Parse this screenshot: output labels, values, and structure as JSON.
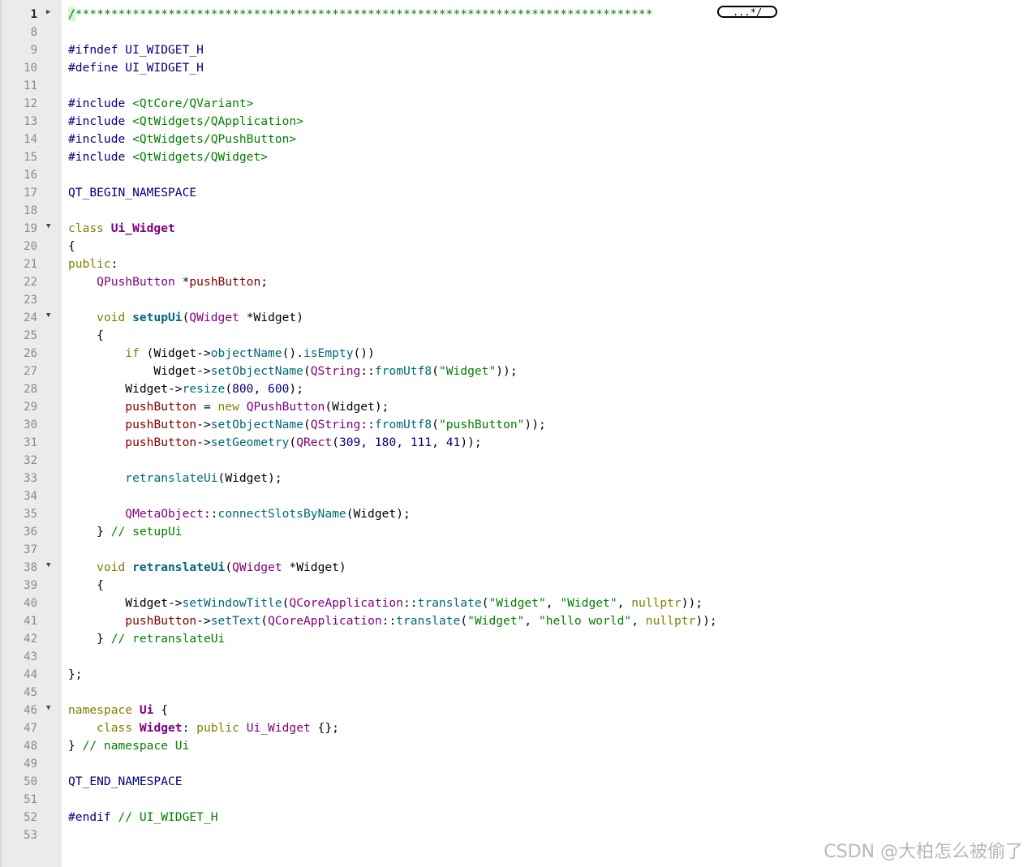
{
  "gutter": {
    "fold_marker_collapsed": "triangle-right-icon",
    "fold_marker_expanded": "triangle-down-icon"
  },
  "lines": [
    {
      "n": "1",
      "current": true,
      "fold": "collapsed",
      "tokens": [
        [
          "t-bar",
          "/"
        ],
        [
          "t-cmt",
          "*********************************************************************************"
        ]
      ],
      "foldBox": "...*/"
    },
    {
      "n": "8",
      "tokens": []
    },
    {
      "n": "9",
      "tokens": [
        [
          "t-pre",
          "#ifndef UI_WIDGET_H"
        ]
      ]
    },
    {
      "n": "10",
      "tokens": [
        [
          "t-pre",
          "#define UI_WIDGET_H"
        ]
      ]
    },
    {
      "n": "11",
      "tokens": []
    },
    {
      "n": "12",
      "tokens": [
        [
          "t-pre",
          "#include "
        ],
        [
          "t-inc",
          "<QtCore/QVariant>"
        ]
      ]
    },
    {
      "n": "13",
      "tokens": [
        [
          "t-pre",
          "#include "
        ],
        [
          "t-inc",
          "<QtWidgets/QApplication>"
        ]
      ]
    },
    {
      "n": "14",
      "tokens": [
        [
          "t-pre",
          "#include "
        ],
        [
          "t-inc",
          "<QtWidgets/QPushButton>"
        ]
      ]
    },
    {
      "n": "15",
      "tokens": [
        [
          "t-pre",
          "#include "
        ],
        [
          "t-inc",
          "<QtWidgets/QWidget>"
        ]
      ]
    },
    {
      "n": "16",
      "tokens": []
    },
    {
      "n": "17",
      "tokens": [
        [
          "t-pre",
          "QT_BEGIN_NAMESPACE"
        ]
      ]
    },
    {
      "n": "18",
      "tokens": []
    },
    {
      "n": "19",
      "fold": "expanded",
      "tokens": [
        [
          "t-kw",
          "class "
        ],
        [
          "t-cls",
          "Ui_Widget"
        ]
      ]
    },
    {
      "n": "20",
      "tokens": [
        [
          "",
          "{"
        ]
      ]
    },
    {
      "n": "21",
      "tokens": [
        [
          "t-kw",
          "public"
        ],
        [
          "",
          ":"
        ]
      ]
    },
    {
      "n": "22",
      "tokens": [
        [
          "",
          "    "
        ],
        [
          "t-type",
          "QPushButton"
        ],
        [
          "",
          " *"
        ],
        [
          "t-fld",
          "pushButton"
        ],
        [
          "",
          ";"
        ]
      ]
    },
    {
      "n": "23",
      "tokens": []
    },
    {
      "n": "24",
      "fold": "expanded",
      "tokens": [
        [
          "",
          "    "
        ],
        [
          "t-kw",
          "void "
        ],
        [
          "t-fnb",
          "setupUi"
        ],
        [
          "",
          "("
        ],
        [
          "t-type",
          "QWidget"
        ],
        [
          "",
          " *Widget)"
        ]
      ]
    },
    {
      "n": "25",
      "tokens": [
        [
          "",
          "    {"
        ]
      ]
    },
    {
      "n": "26",
      "tokens": [
        [
          "",
          "        "
        ],
        [
          "t-kw",
          "if"
        ],
        [
          "",
          " (Widget->"
        ],
        [
          "t-fn",
          "objectName"
        ],
        [
          "",
          "()."
        ],
        [
          "t-fn",
          "isEmpty"
        ],
        [
          "",
          "())"
        ]
      ]
    },
    {
      "n": "27",
      "tokens": [
        [
          "",
          "            Widget->"
        ],
        [
          "t-fn",
          "setObjectName"
        ],
        [
          "",
          "("
        ],
        [
          "t-type",
          "QString"
        ],
        [
          "",
          "::"
        ],
        [
          "t-fn",
          "fromUtf8"
        ],
        [
          "",
          "("
        ],
        [
          "t-str",
          "\"Widget\""
        ],
        [
          "",
          "));"
        ]
      ]
    },
    {
      "n": "28",
      "tokens": [
        [
          "",
          "        Widget->"
        ],
        [
          "t-fn",
          "resize"
        ],
        [
          "",
          "("
        ],
        [
          "t-num",
          "800"
        ],
        [
          "",
          ", "
        ],
        [
          "t-num",
          "600"
        ],
        [
          "",
          ");"
        ]
      ]
    },
    {
      "n": "29",
      "tokens": [
        [
          "",
          "        "
        ],
        [
          "t-fld",
          "pushButton"
        ],
        [
          "",
          " = "
        ],
        [
          "t-kw",
          "new "
        ],
        [
          "t-type",
          "QPushButton"
        ],
        [
          "",
          "(Widget);"
        ]
      ]
    },
    {
      "n": "30",
      "tokens": [
        [
          "",
          "        "
        ],
        [
          "t-fld",
          "pushButton"
        ],
        [
          "",
          "->"
        ],
        [
          "t-fn",
          "setObjectName"
        ],
        [
          "",
          "("
        ],
        [
          "t-type",
          "QString"
        ],
        [
          "",
          "::"
        ],
        [
          "t-fn",
          "fromUtf8"
        ],
        [
          "",
          "("
        ],
        [
          "t-str",
          "\"pushButton\""
        ],
        [
          "",
          "));"
        ]
      ]
    },
    {
      "n": "31",
      "tokens": [
        [
          "",
          "        "
        ],
        [
          "t-fld",
          "pushButton"
        ],
        [
          "",
          "->"
        ],
        [
          "t-fn",
          "setGeometry"
        ],
        [
          "",
          "("
        ],
        [
          "t-type",
          "QRect"
        ],
        [
          "",
          "("
        ],
        [
          "t-num",
          "309"
        ],
        [
          "",
          ", "
        ],
        [
          "t-num",
          "180"
        ],
        [
          "",
          ", "
        ],
        [
          "t-num",
          "111"
        ],
        [
          "",
          ", "
        ],
        [
          "t-num",
          "41"
        ],
        [
          "",
          "));"
        ]
      ]
    },
    {
      "n": "32",
      "tokens": []
    },
    {
      "n": "33",
      "tokens": [
        [
          "",
          "        "
        ],
        [
          "t-fn",
          "retranslateUi"
        ],
        [
          "",
          "(Widget);"
        ]
      ]
    },
    {
      "n": "34",
      "tokens": []
    },
    {
      "n": "35",
      "tokens": [
        [
          "",
          "        "
        ],
        [
          "t-type",
          "QMetaObject"
        ],
        [
          "",
          "::"
        ],
        [
          "t-fn",
          "connectSlotsByName"
        ],
        [
          "",
          "(Widget);"
        ]
      ]
    },
    {
      "n": "36",
      "tokens": [
        [
          "",
          "    } "
        ],
        [
          "t-cmt",
          "// setupUi"
        ]
      ]
    },
    {
      "n": "37",
      "tokens": []
    },
    {
      "n": "38",
      "fold": "expanded",
      "tokens": [
        [
          "",
          "    "
        ],
        [
          "t-kw",
          "void "
        ],
        [
          "t-fnb",
          "retranslateUi"
        ],
        [
          "",
          "("
        ],
        [
          "t-type",
          "QWidget"
        ],
        [
          "",
          " *Widget)"
        ]
      ]
    },
    {
      "n": "39",
      "tokens": [
        [
          "",
          "    {"
        ]
      ]
    },
    {
      "n": "40",
      "tokens": [
        [
          "",
          "        Widget->"
        ],
        [
          "t-fn",
          "setWindowTitle"
        ],
        [
          "",
          "("
        ],
        [
          "t-type",
          "QCoreApplication"
        ],
        [
          "",
          "::"
        ],
        [
          "t-fn",
          "translate"
        ],
        [
          "",
          "("
        ],
        [
          "t-str",
          "\"Widget\""
        ],
        [
          "",
          ", "
        ],
        [
          "t-str",
          "\"Widget\""
        ],
        [
          "",
          ", "
        ],
        [
          "t-kw",
          "nullptr"
        ],
        [
          "",
          "));"
        ]
      ]
    },
    {
      "n": "41",
      "tokens": [
        [
          "",
          "        "
        ],
        [
          "t-fld",
          "pushButton"
        ],
        [
          "",
          "->"
        ],
        [
          "t-fn",
          "setText"
        ],
        [
          "",
          "("
        ],
        [
          "t-type",
          "QCoreApplication"
        ],
        [
          "",
          "::"
        ],
        [
          "t-fn",
          "translate"
        ],
        [
          "",
          "("
        ],
        [
          "t-str",
          "\"Widget\""
        ],
        [
          "",
          ", "
        ],
        [
          "t-str",
          "\"hello world\""
        ],
        [
          "",
          ", "
        ],
        [
          "t-kw",
          "nullptr"
        ],
        [
          "",
          "));"
        ]
      ]
    },
    {
      "n": "42",
      "tokens": [
        [
          "",
          "    } "
        ],
        [
          "t-cmt",
          "// retranslateUi"
        ]
      ]
    },
    {
      "n": "43",
      "tokens": []
    },
    {
      "n": "44",
      "tokens": [
        [
          "",
          "};"
        ]
      ]
    },
    {
      "n": "45",
      "tokens": []
    },
    {
      "n": "46",
      "fold": "expanded",
      "tokens": [
        [
          "t-kw",
          "namespace "
        ],
        [
          "t-cls",
          "Ui"
        ],
        [
          "",
          " {"
        ]
      ]
    },
    {
      "n": "47",
      "tokens": [
        [
          "",
          "    "
        ],
        [
          "t-kw",
          "class "
        ],
        [
          "t-cls",
          "Widget"
        ],
        [
          "",
          ": "
        ],
        [
          "t-kw",
          "public "
        ],
        [
          "t-type",
          "Ui_Widget"
        ],
        [
          "",
          " {};"
        ]
      ]
    },
    {
      "n": "48",
      "tokens": [
        [
          "",
          "} "
        ],
        [
          "t-cmt",
          "// namespace Ui"
        ]
      ]
    },
    {
      "n": "49",
      "tokens": []
    },
    {
      "n": "50",
      "tokens": [
        [
          "t-pre",
          "QT_END_NAMESPACE"
        ]
      ]
    },
    {
      "n": "51",
      "tokens": []
    },
    {
      "n": "52",
      "tokens": [
        [
          "t-pre",
          "#endif "
        ],
        [
          "t-cmt",
          "// UI_WIDGET_H"
        ]
      ]
    },
    {
      "n": "53",
      "tokens": []
    }
  ],
  "watermark": "CSDN @大柏怎么被偷了"
}
